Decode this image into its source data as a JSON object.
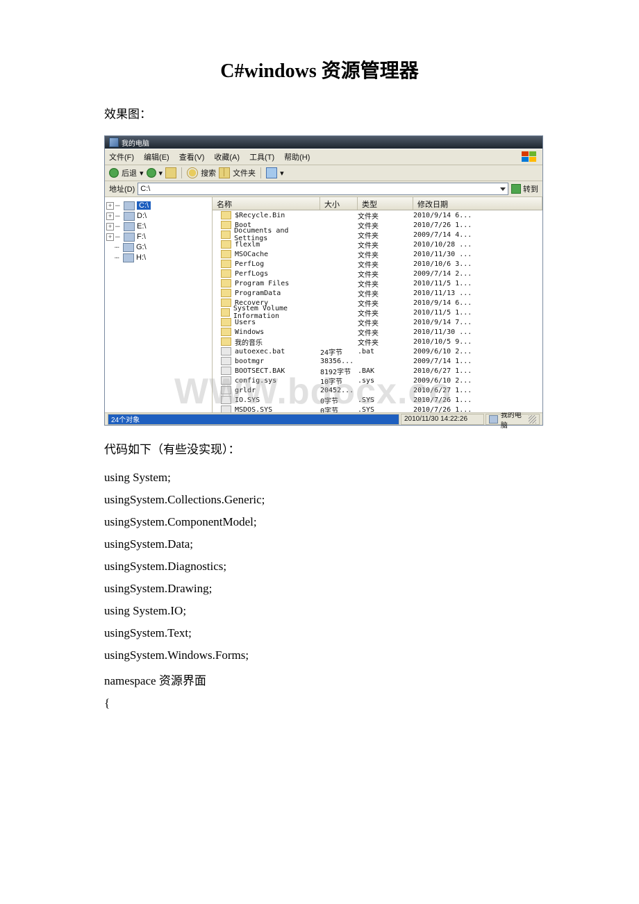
{
  "title": "C#windows 资源管理器",
  "caption_top": "效果图：",
  "caption_code": "代码如下（有些没实现）：",
  "code": [
    "using System;",
    "usingSystem.Collections.Generic;",
    "usingSystem.ComponentModel;",
    "usingSystem.Data;",
    "usingSystem.Diagnostics;",
    "usingSystem.Drawing;",
    "using System.IO;",
    "usingSystem.Text;",
    "usingSystem.Windows.Forms;",
    "namespace 资源界面",
    "{"
  ],
  "window": {
    "title": "我的电脑",
    "menu": [
      "文件(F)",
      "编辑(E)",
      "查看(V)",
      "收藏(A)",
      "工具(T)",
      "帮助(H)"
    ],
    "toolbar": {
      "back": "后退",
      "search": "搜索",
      "folders": "文件夹"
    },
    "address_label": "地址(D)",
    "address_value": "C:\\",
    "go": "转到",
    "tree": [
      "C:\\",
      "D:\\",
      "E:\\",
      "F:\\",
      "G:\\",
      "H:\\"
    ],
    "columns": {
      "name": "名称",
      "size": "大小",
      "type": "类型",
      "date": "修改日期"
    },
    "rows": [
      {
        "name": "$Recycle.Bin",
        "size": "",
        "type": "文件夹",
        "date": "2010/9/14 6...",
        "kind": "folder"
      },
      {
        "name": "Boot",
        "size": "",
        "type": "文件夹",
        "date": "2010/7/26 1...",
        "kind": "folder"
      },
      {
        "name": "Documents and Settings",
        "size": "",
        "type": "文件夹",
        "date": "2009/7/14 4...",
        "kind": "folder"
      },
      {
        "name": "flexlm",
        "size": "",
        "type": "文件夹",
        "date": "2010/10/28 ...",
        "kind": "folder"
      },
      {
        "name": "MSOCache",
        "size": "",
        "type": "文件夹",
        "date": "2010/11/30 ...",
        "kind": "folder"
      },
      {
        "name": "PerfLog",
        "size": "",
        "type": "文件夹",
        "date": "2010/10/6 3...",
        "kind": "folder"
      },
      {
        "name": "PerfLogs",
        "size": "",
        "type": "文件夹",
        "date": "2009/7/14 2...",
        "kind": "folder"
      },
      {
        "name": "Program Files",
        "size": "",
        "type": "文件夹",
        "date": "2010/11/5 1...",
        "kind": "folder"
      },
      {
        "name": "ProgramData",
        "size": "",
        "type": "文件夹",
        "date": "2010/11/13 ...",
        "kind": "folder"
      },
      {
        "name": "Recovery",
        "size": "",
        "type": "文件夹",
        "date": "2010/9/14 6...",
        "kind": "folder"
      },
      {
        "name": "System Volume Information",
        "size": "",
        "type": "文件夹",
        "date": "2010/11/5 1...",
        "kind": "folder"
      },
      {
        "name": "Users",
        "size": "",
        "type": "文件夹",
        "date": "2010/9/14 7...",
        "kind": "folder"
      },
      {
        "name": "Windows",
        "size": "",
        "type": "文件夹",
        "date": "2010/11/30 ...",
        "kind": "folder"
      },
      {
        "name": "我的音乐",
        "size": "",
        "type": "文件夹",
        "date": "2010/10/5 9...",
        "kind": "folder"
      },
      {
        "name": "autoexec.bat",
        "size": "24字节",
        "type": ".bat",
        "date": "2009/6/10 2...",
        "kind": "file"
      },
      {
        "name": "bootmgr",
        "size": "38356...",
        "type": "",
        "date": "2009/7/14 1...",
        "kind": "file"
      },
      {
        "name": "BOOTSECT.BAK",
        "size": "8192字节",
        "type": ".BAK",
        "date": "2010/6/27 1...",
        "kind": "file"
      },
      {
        "name": "config.sys",
        "size": "10字节",
        "type": ".sys",
        "date": "2009/6/10 2...",
        "kind": "file"
      },
      {
        "name": "grldr",
        "size": "20452...",
        "type": "",
        "date": "2010/6/27 1...",
        "kind": "file"
      },
      {
        "name": "IO.SYS",
        "size": "0字节",
        "type": ".SYS",
        "date": "2010/7/26 1...",
        "kind": "file"
      },
      {
        "name": "MSDOS.SYS",
        "size": "0字节",
        "type": ".SYS",
        "date": "2010/7/26 1...",
        "kind": "file"
      }
    ],
    "status": {
      "objects": "24个对象",
      "timestamp": "2010/11/30 14:22:26",
      "location": "我的电脑"
    },
    "watermark": "WWW.bdocx.co"
  }
}
